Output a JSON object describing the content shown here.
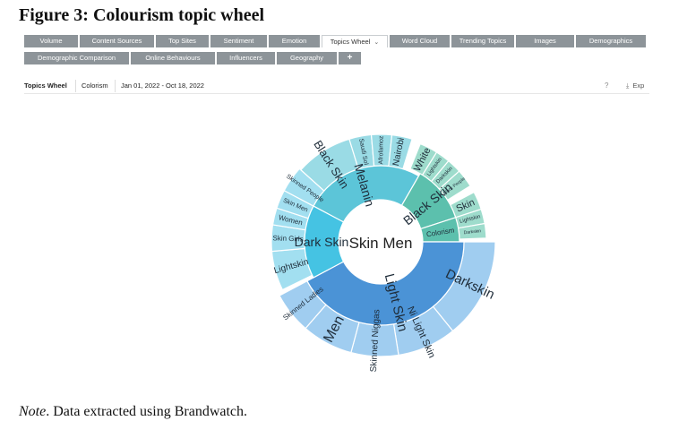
{
  "figure": {
    "title": "Figure 3: Colourism topic wheel",
    "note_prefix": "Note",
    "note_text": ". Data extracted using Brandwatch."
  },
  "tabs_row1": [
    {
      "label": "Volume",
      "active": false
    },
    {
      "label": "Content Sources",
      "active": false
    },
    {
      "label": "Top Sites",
      "active": false
    },
    {
      "label": "Sentiment",
      "active": false
    },
    {
      "label": "Emotion",
      "active": false
    },
    {
      "label": "Topics Wheel",
      "active": true
    },
    {
      "label": "Word Cloud",
      "active": false
    },
    {
      "label": "Trending Topics",
      "active": false
    },
    {
      "label": "Images",
      "active": false
    },
    {
      "label": "Demographics",
      "active": false
    }
  ],
  "tabs_row2": [
    {
      "label": "Demographic Comparison"
    },
    {
      "label": "Online Behaviours"
    },
    {
      "label": "Influencers"
    },
    {
      "label": "Geography"
    },
    {
      "label": "+"
    }
  ],
  "filter_bar": {
    "label": "Topics Wheel",
    "topic": "Colorism",
    "date_range": "Jan 01, 2022 - Oct 18, 2022",
    "help_glyph": "?",
    "export_label": "Exp"
  },
  "wheel": {
    "center": "Skin Men",
    "inner_ring": [
      {
        "label": "Melanin",
        "color": "#5cc5d8"
      },
      {
        "label": "Black Skin",
        "color": "#5cc0ad"
      },
      {
        "label": "Colorism",
        "color": "#5cc0ad"
      },
      {
        "label": "Light Skin",
        "color": "#4b93d6"
      },
      {
        "label": "Dark Skin",
        "color": "#45c3e3"
      }
    ],
    "outer_ring": [
      {
        "label": "Black Skin",
        "color": "#9adbe5"
      },
      {
        "label": "Saudi Sol",
        "color": "#9adbe5"
      },
      {
        "label": "Afrofamoz",
        "color": "#9adbe5"
      },
      {
        "label": "Nairobi",
        "color": "#9adbe5"
      },
      {
        "label": "White",
        "color": "#9edccc"
      },
      {
        "label": "Lightskin",
        "color": "#9edccc"
      },
      {
        "label": "Darkskin",
        "color": "#9edccc"
      },
      {
        "label": "Black People",
        "color": "#9edccc"
      },
      {
        "label": "Skin",
        "color": "#9edccc"
      },
      {
        "label": "Lightskin",
        "color": "#9edccc"
      },
      {
        "label": "Darkskin",
        "color": "#9edccc"
      },
      {
        "label": "Darkskin",
        "color": "#a0cdf0"
      },
      {
        "label": "Ni Light Skin",
        "color": "#a0cdf0"
      },
      {
        "label": "Skinned Niggas",
        "color": "#a0cdf0"
      },
      {
        "label": "Men",
        "color": "#a0cdf0"
      },
      {
        "label": "Skinned Ladies",
        "color": "#a0cdf0"
      },
      {
        "label": "Lightskin",
        "color": "#a2dff0"
      },
      {
        "label": "Skin Girls",
        "color": "#a2dff0"
      },
      {
        "label": "Women",
        "color": "#a2dff0"
      },
      {
        "label": "Skin Men",
        "color": "#a2dff0"
      },
      {
        "label": "Skinned People",
        "color": "#a2dff0"
      }
    ]
  }
}
